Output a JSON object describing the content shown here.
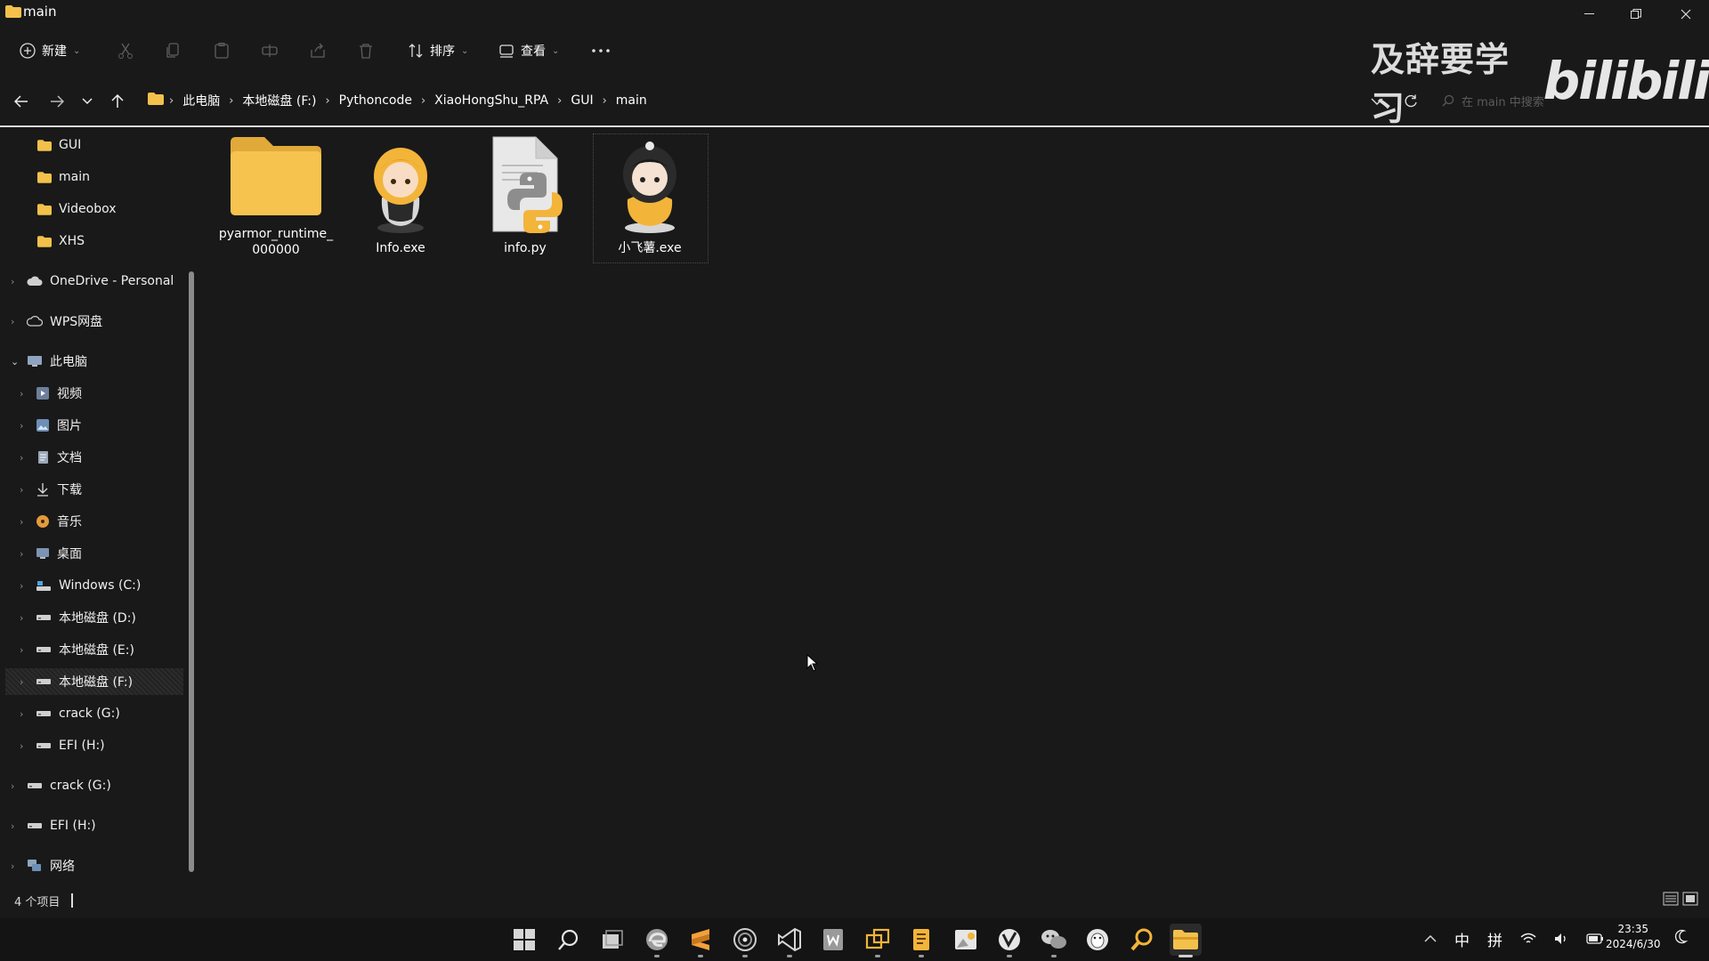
{
  "window": {
    "title": "main"
  },
  "toolbar": {
    "new_label": "新建",
    "sort_label": "排序",
    "view_label": "查看"
  },
  "breadcrumb": [
    "此电脑",
    "本地磁盘 (F:)",
    "Pythoncode",
    "XiaoHongShu_RPA",
    "GUI",
    "main"
  ],
  "search": {
    "placeholder": "在 main 中搜索"
  },
  "sidebar": {
    "items": [
      {
        "label": "GUI",
        "icon": "folder-icon"
      },
      {
        "label": "main",
        "icon": "folder-icon"
      },
      {
        "label": "Videobox",
        "icon": "folder-icon"
      },
      {
        "label": "XHS",
        "icon": "folder-icon"
      },
      {
        "label": "OneDrive - Personal",
        "icon": "cloud-icon"
      },
      {
        "label": "WPS网盘",
        "icon": "cloud-outline-icon"
      },
      {
        "label": "此电脑",
        "icon": "computer-icon"
      },
      {
        "label": "视频",
        "icon": "video-icon"
      },
      {
        "label": "图片",
        "icon": "pictures-icon"
      },
      {
        "label": "文档",
        "icon": "document-icon"
      },
      {
        "label": "下载",
        "icon": "download-icon"
      },
      {
        "label": "音乐",
        "icon": "music-icon"
      },
      {
        "label": "桌面",
        "icon": "desktop-icon"
      },
      {
        "label": "Windows (C:)",
        "icon": "os-drive-icon"
      },
      {
        "label": "本地磁盘 (D:)",
        "icon": "drive-icon"
      },
      {
        "label": "本地磁盘 (E:)",
        "icon": "drive-icon"
      },
      {
        "label": "本地磁盘 (F:)",
        "icon": "drive-icon"
      },
      {
        "label": "crack (G:)",
        "icon": "drive-icon"
      },
      {
        "label": "EFI (H:)",
        "icon": "drive-icon"
      },
      {
        "label": "crack (G:)",
        "icon": "drive-icon"
      },
      {
        "label": "EFI (H:)",
        "icon": "drive-icon"
      },
      {
        "label": "网络",
        "icon": "network-icon"
      }
    ]
  },
  "files": [
    {
      "name": "pyarmor_runtime_000000",
      "icon": "folder-icon"
    },
    {
      "name": "Info.exe",
      "icon": "anime-girl-icon"
    },
    {
      "name": "info.py",
      "icon": "python-file-icon"
    },
    {
      "name": "小飞薯.exe",
      "icon": "anime-girl-icon"
    }
  ],
  "status": {
    "item_count": "4 个项目"
  },
  "watermark": {
    "text": "及辞要学习",
    "logo": "bilibili"
  },
  "clock": {
    "time": "23:35",
    "date": "2024/6/30"
  },
  "tray": {
    "ime_lang": "中",
    "ime_mode": "拼"
  },
  "colors": {
    "background": "#191919",
    "folder": "#f3c14b",
    "accent_yellow": "#f3b43a"
  }
}
